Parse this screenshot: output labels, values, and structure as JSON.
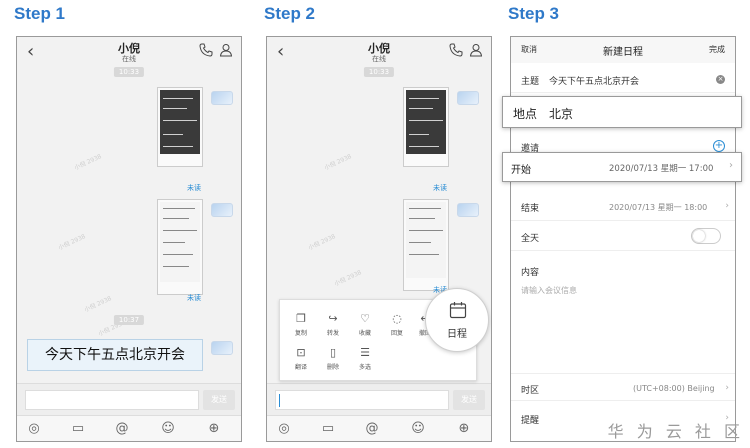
{
  "steps": [
    "Step 1",
    "Step 2",
    "Step 3"
  ],
  "chat": {
    "contact_name": "小倪",
    "contact_status": "在线",
    "time_1": "10:33",
    "time_2": "10:37",
    "unread": "未读",
    "watermark": "小倪 2938",
    "send_label": "发送",
    "message_text": "今天下午五点北京开会",
    "icons": {
      "back": "chevron-left-icon",
      "phone": "phone-icon",
      "contact": "person-icon",
      "voice": "voice-icon",
      "image": "image-icon",
      "mention": "at-icon",
      "emoji": "emoji-icon",
      "more": "plus-icon"
    }
  },
  "context_menu": {
    "items": [
      {
        "label": "复制",
        "icon": "copy-icon"
      },
      {
        "label": "转发",
        "icon": "forward-icon"
      },
      {
        "label": "收藏",
        "icon": "heart-icon"
      },
      {
        "label": "回复",
        "icon": "reply-bubble-icon"
      },
      {
        "label": "撤回",
        "icon": "undo-icon"
      },
      {
        "label": "翻译",
        "icon": "translate-icon"
      },
      {
        "label": "删除",
        "icon": "trash-icon"
      },
      {
        "label": "多选",
        "icon": "multiselect-icon"
      }
    ],
    "schedule_label": "日程"
  },
  "schedule_form": {
    "cancel": "取消",
    "title": "新建日程",
    "done": "完成",
    "subject_label": "主题",
    "subject_value": "今天下午五点北京开会",
    "location_label": "地点",
    "location_value": "北京",
    "invite_label": "邀请",
    "start_label": "开始",
    "start_value": "2020/07/13 星期一 17:00",
    "end_label": "结束",
    "end_value": "2020/07/13 星期一 18:00",
    "allday_label": "全天",
    "content_label": "内容",
    "content_placeholder": "请输入会议信息",
    "timezone_label": "时区",
    "timezone_value": "(UTC+08:00) Beijing",
    "reminder_label": "提醒"
  },
  "footer_watermark": "华 为 云 社 区",
  "colors": {
    "accent": "#2f79c9",
    "link": "#2a8dd4"
  }
}
